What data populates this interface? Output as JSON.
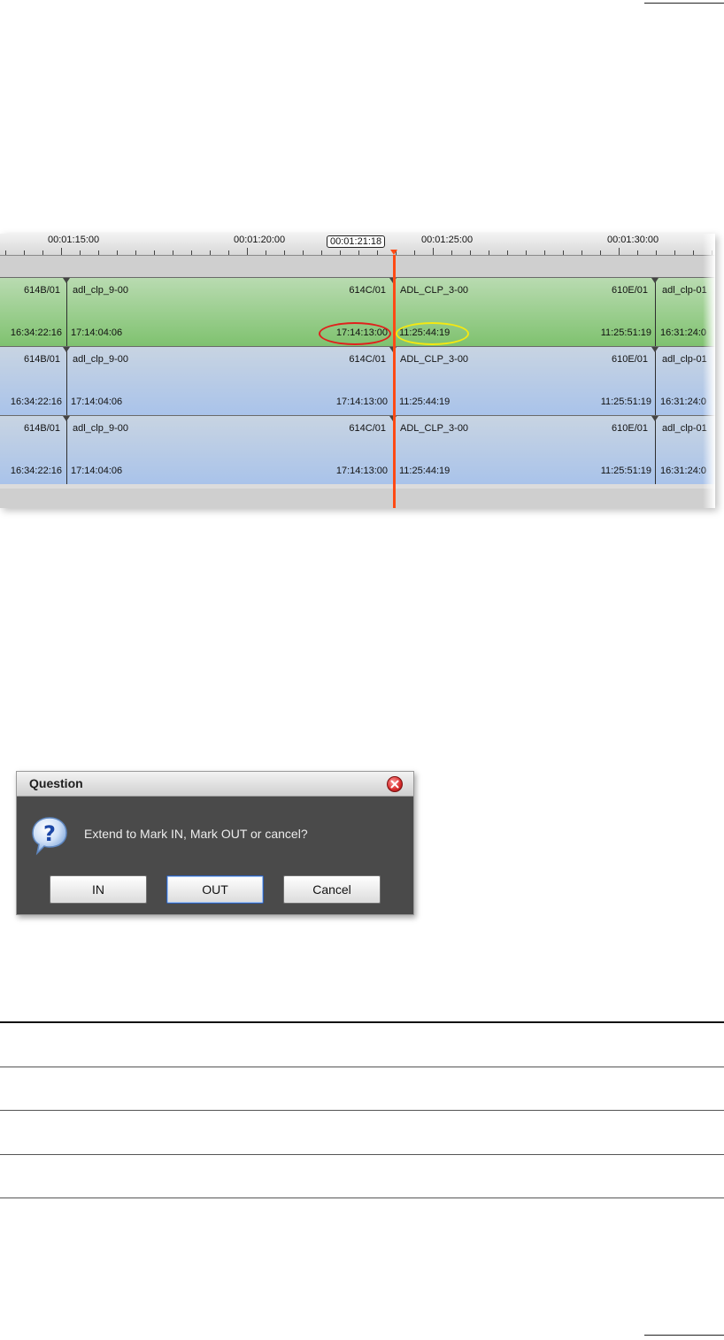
{
  "timeline": {
    "ruler_labels": [
      "00:01:15:00",
      "00:01:20:00",
      "00:01:25:00",
      "00:01:30:00"
    ],
    "current_timecode": "00:01:21:18",
    "clip_names": [
      "614B/01",
      "adl_clp_9-00",
      "614C/01",
      "ADL_CLP_3-00",
      "610E/01",
      "adl_clp-01"
    ],
    "clip_timecodes": [
      "16:34:22:16",
      "17:14:04:06",
      "17:14:13:00",
      "11:25:44:19",
      "11:25:51:19",
      "16:31:24:0"
    ],
    "tracks": [
      {
        "color": "green",
        "selected": true
      },
      {
        "color": "blue",
        "selected": false
      },
      {
        "color": "blue",
        "selected": false
      }
    ],
    "highlight_colors": {
      "out_point": "#e0201c",
      "in_point": "#f4e812"
    },
    "playhead_color": "#ff4a14"
  },
  "dialog": {
    "title": "Question",
    "message": "Extend to Mark IN, Mark OUT or cancel?",
    "buttons": {
      "in": "IN",
      "out": "OUT",
      "cancel": "Cancel"
    },
    "icons": {
      "close": "close-icon",
      "question": "question-icon"
    }
  }
}
